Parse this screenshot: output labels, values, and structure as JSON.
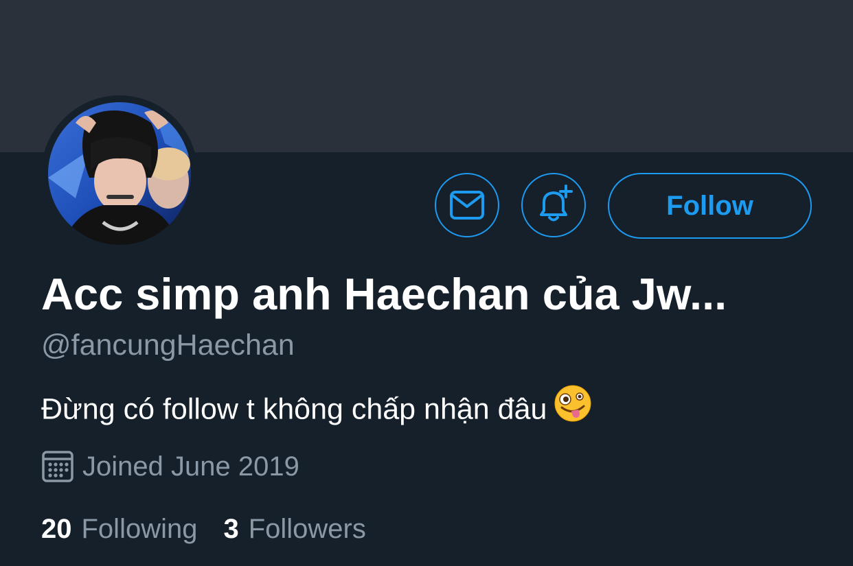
{
  "profile": {
    "display_name": "Acc simp anh Haechan của Jw...",
    "handle": "@fancungHaechan",
    "bio": "Đừng có follow t không chấp nhận đâu",
    "bio_emoji": "zany-face-icon",
    "joined": "Joined June 2019"
  },
  "actions": {
    "message_icon": "mail-icon",
    "notify_icon": "bell-plus-icon",
    "follow_label": "Follow"
  },
  "stats": {
    "following_count": "20",
    "following_label": "Following",
    "followers_count": "3",
    "followers_label": "Followers"
  },
  "colors": {
    "background": "#15202b",
    "banner": "#2a313a",
    "accent": "#1d9bf0",
    "secondary_text": "#8b98a5"
  }
}
